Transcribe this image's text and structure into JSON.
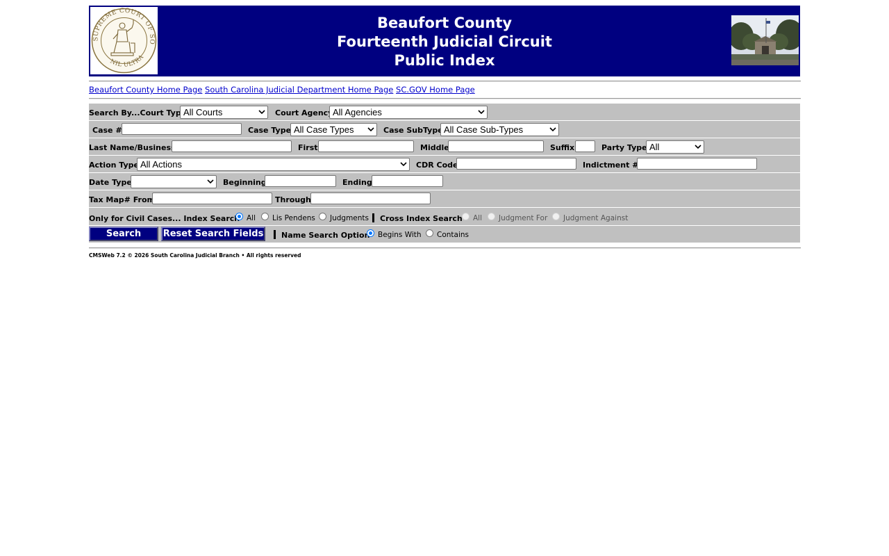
{
  "header": {
    "line1": "Beaufort County",
    "line2": "Fourteenth Judicial Circuit",
    "line3": "Public Index",
    "seal_top_text": "SUPREME COURT OF SOUTH CAROLINA",
    "seal_bottom_text": "NIL ULTRA"
  },
  "links": [
    {
      "label": "Beaufort County Home Page"
    },
    {
      "label": "South Carolina Judicial Department Home Page"
    },
    {
      "label": "SC.GOV Home Page"
    }
  ],
  "form": {
    "search_by_label": "Search By...Court Type",
    "court_type_value": "All Courts",
    "court_agency_label": "Court Agency",
    "court_agency_value": "All Agencies",
    "case_num_label": "Case #",
    "case_num_value": "",
    "case_type_label": "Case Type",
    "case_type_value": "All Case Types",
    "case_subtype_label": "Case SubType",
    "case_subtype_value": "All Case Sub-Types",
    "last_name_label": "Last Name/Business",
    "last_name_value": "",
    "first_label": "First",
    "first_value": "",
    "middle_label": "Middle",
    "middle_value": "",
    "suffix_label": "Suffix",
    "suffix_value": "",
    "party_type_label": "Party Type",
    "party_type_value": "All",
    "action_type_label": "Action Type",
    "action_type_value": "All Actions",
    "cdr_code_label": "CDR Code",
    "cdr_code_value": "",
    "indictment_label": "Indictment #",
    "indictment_value": "",
    "date_type_label": "Date Type",
    "date_type_value": "",
    "beginning_label": "Beginning",
    "beginning_value": "",
    "ending_label": "Ending",
    "ending_value": "",
    "tax_map_label": "Tax Map# From",
    "tax_map_value": "",
    "through_label": "Through",
    "through_value": "",
    "civil_label": "Only for Civil Cases... Index Search",
    "index_all_label": "All",
    "lis_pendens_label": "Lis Pendens",
    "judgments_label": "Judgments",
    "cross_index_label": "Cross Index Search",
    "cross_all_label": "All",
    "judgment_for_label": "Judgment For",
    "judgment_against_label": "Judgment Against",
    "search_button": "Search",
    "reset_button": "Reset Search Fields",
    "name_search_label": "Name Search Option",
    "begins_with_label": "Begins With",
    "contains_label": "Contains"
  },
  "footer": {
    "text": "CMSWeb 7.2 © 2026 South Carolina Judicial Branch • All rights reserved"
  },
  "colors": {
    "banner": "#000080",
    "form_row": "#c0c0c0",
    "link": "#0000cc",
    "radio_checked": "#0075ff"
  }
}
